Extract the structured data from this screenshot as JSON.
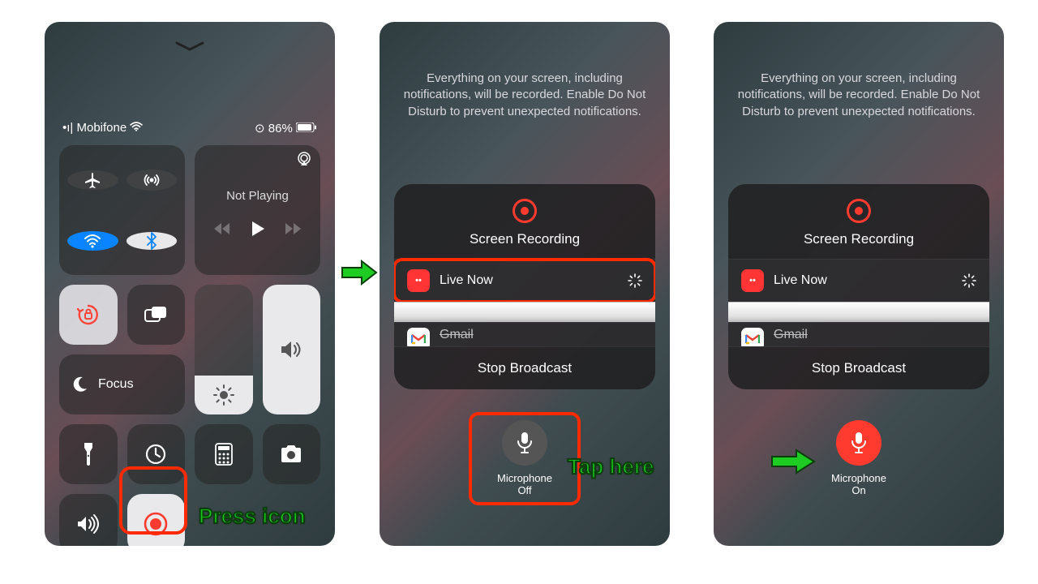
{
  "status": {
    "carrier": "Mobifone",
    "battery": "86%"
  },
  "media": {
    "title": "Not Playing"
  },
  "focus": {
    "label": "Focus"
  },
  "annotations": {
    "press_icon": "Press icon",
    "tap_here": "Tap here"
  },
  "broadcast": {
    "info": "Everything on your screen, including notifications, will be recorded. Enable Do Not Disturb to prevent unexpected notifications.",
    "title": "Screen Recording",
    "option_live": "Live Now",
    "option_gmail": "Gmail",
    "stop": "Stop Broadcast"
  },
  "mic": {
    "label": "Microphone",
    "state_off": "Off",
    "state_on": "On"
  }
}
